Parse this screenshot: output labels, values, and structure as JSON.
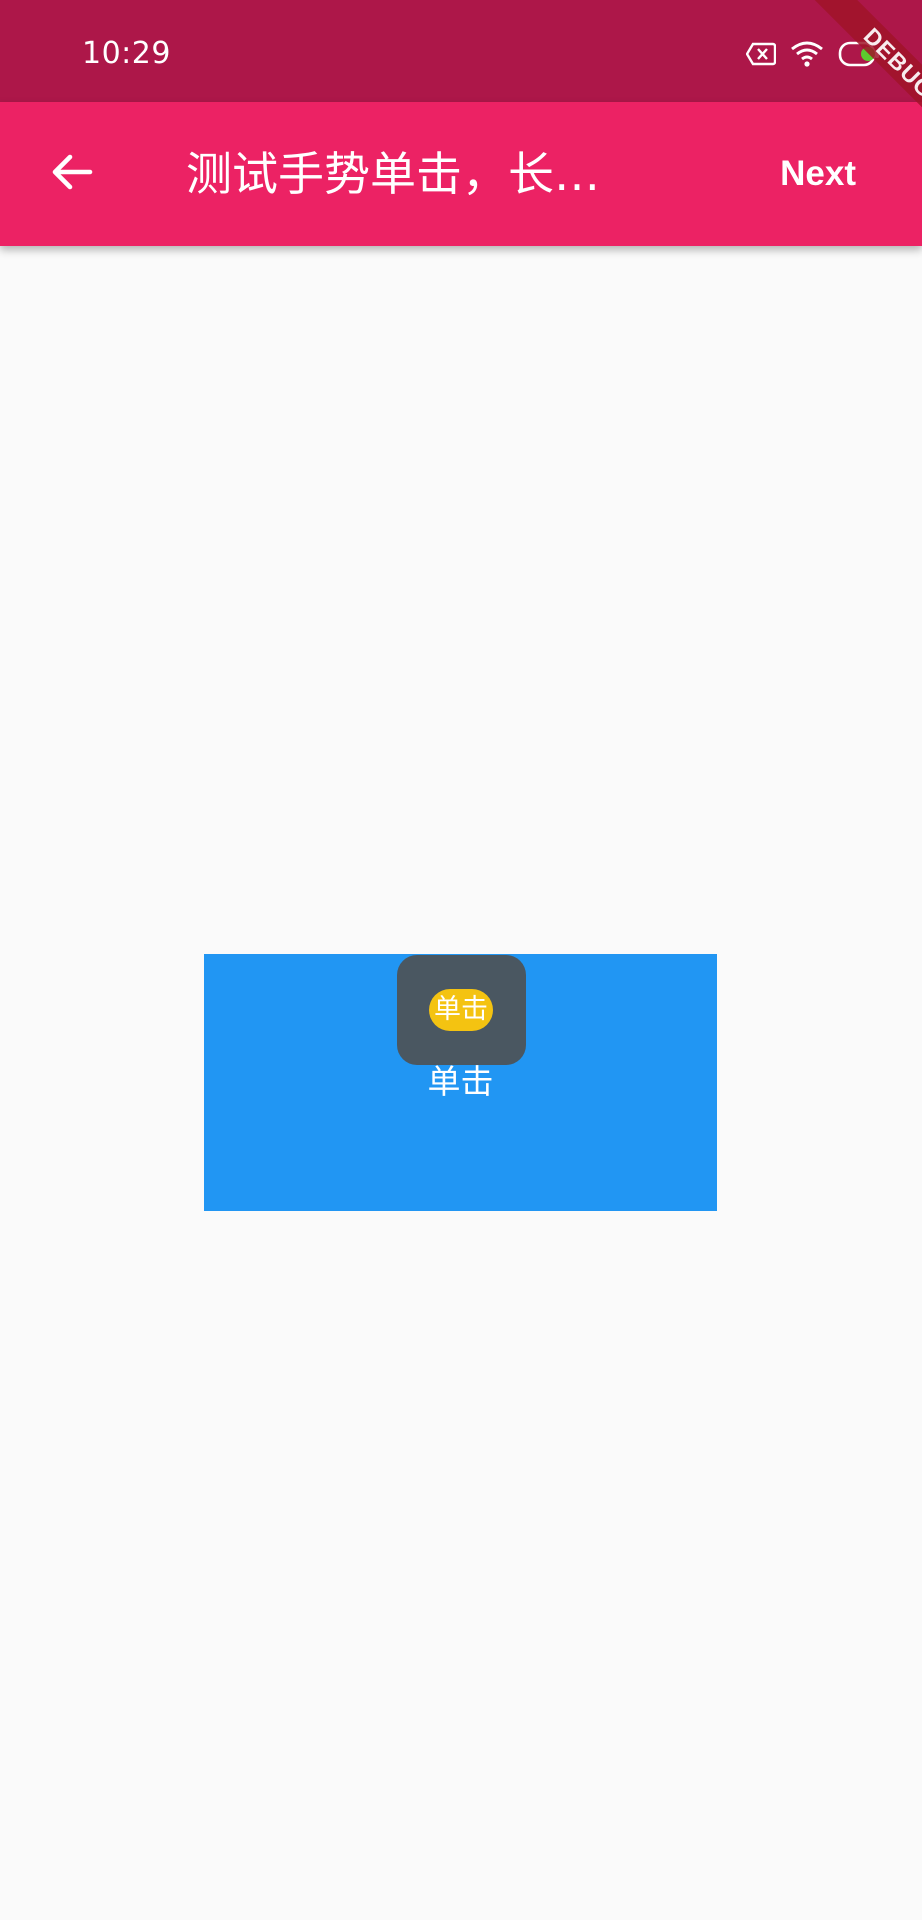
{
  "status_bar": {
    "time": "10:29",
    "icons": [
      "no-sim-icon",
      "wifi-icon",
      "battery-icon"
    ]
  },
  "app_bar": {
    "back_icon": "arrow-back-icon",
    "title": "测试手势单击，长…",
    "next_label": "Next"
  },
  "debug_banner": {
    "label": "DEBUG"
  },
  "gesture_area": {
    "label": "单击"
  },
  "toast": {
    "message": "单击"
  },
  "colors": {
    "status_bar": "#AD1749",
    "app_bar": "#EC2264",
    "background": "#FAFAFA",
    "gesture_box": "#2196F3",
    "toast_bg": "#4A5761",
    "toast_chip": "#F4C311"
  }
}
